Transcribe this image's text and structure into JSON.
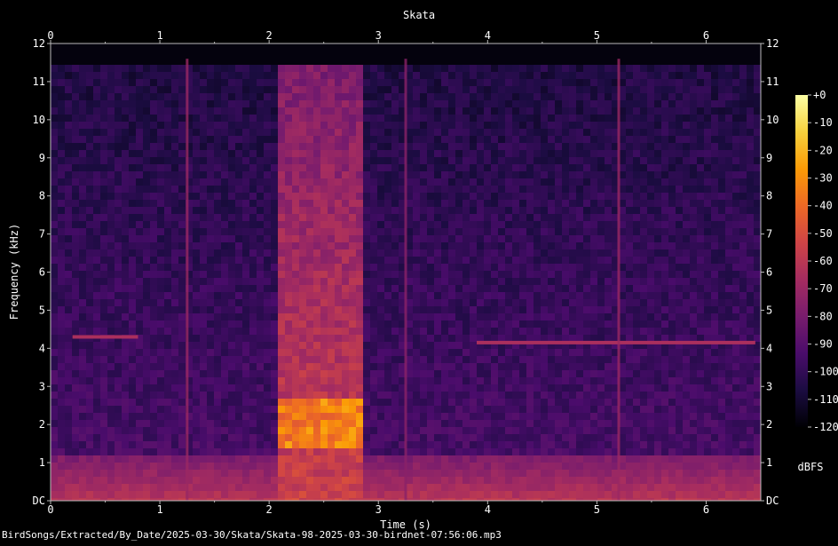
{
  "chart_data": {
    "type": "heatmap",
    "title": "Skata",
    "xlabel": "Time (s)",
    "ylabel": "Frequency (kHz)",
    "xlim": [
      0,
      6.5
    ],
    "ylim": [
      0,
      12
    ],
    "x_ticks": [
      "0",
      "1",
      "2",
      "3",
      "4",
      "5",
      "6"
    ],
    "y_ticks": [
      "DC",
      "1",
      "2",
      "3",
      "4",
      "5",
      "6",
      "7",
      "8",
      "9",
      "10",
      "11",
      "12"
    ],
    "colorbar": {
      "label": "dBFS",
      "range": [
        -120,
        0
      ],
      "ticks": [
        "+0",
        "-10",
        "-20",
        "-30",
        "-40",
        "-50",
        "-60",
        "-70",
        "-80",
        "-90",
        "-100",
        "-110",
        "-120"
      ]
    },
    "colormap_stops": [
      "#000004",
      "#1b0c41",
      "#4a0c6b",
      "#781c6d",
      "#a52c60",
      "#cf4446",
      "#ed6925",
      "#fb9b06",
      "#f7d13d",
      "#fcffa4"
    ],
    "features": [
      {
        "type": "broadband_burst",
        "t": [
          2.05,
          2.8
        ],
        "f": [
          0,
          11.7
        ],
        "level_dbfs": -55
      },
      {
        "type": "hot_spot",
        "t": [
          2.05,
          2.8
        ],
        "f": [
          1.5,
          2.8
        ],
        "level_dbfs": -25
      },
      {
        "type": "low_freq_noise",
        "t": [
          0,
          6.5
        ],
        "f": [
          0,
          1.2
        ],
        "level_dbfs": -60
      },
      {
        "type": "tone",
        "t": [
          0.2,
          0.8
        ],
        "f": 4.3,
        "level_dbfs": -65
      },
      {
        "type": "tone",
        "t": [
          3.9,
          6.45
        ],
        "f": 4.15,
        "level_dbfs": -65
      },
      {
        "type": "click",
        "t": 1.25,
        "level_dbfs": -70
      },
      {
        "type": "click",
        "t": 3.25,
        "level_dbfs": -75
      },
      {
        "type": "click",
        "t": 5.2,
        "level_dbfs": -70
      }
    ]
  },
  "footer": "BirdSongs/Extracted/By_Date/2025-03-30/Skata/Skata-98-2025-03-30-birdnet-07:56:06.mp3"
}
